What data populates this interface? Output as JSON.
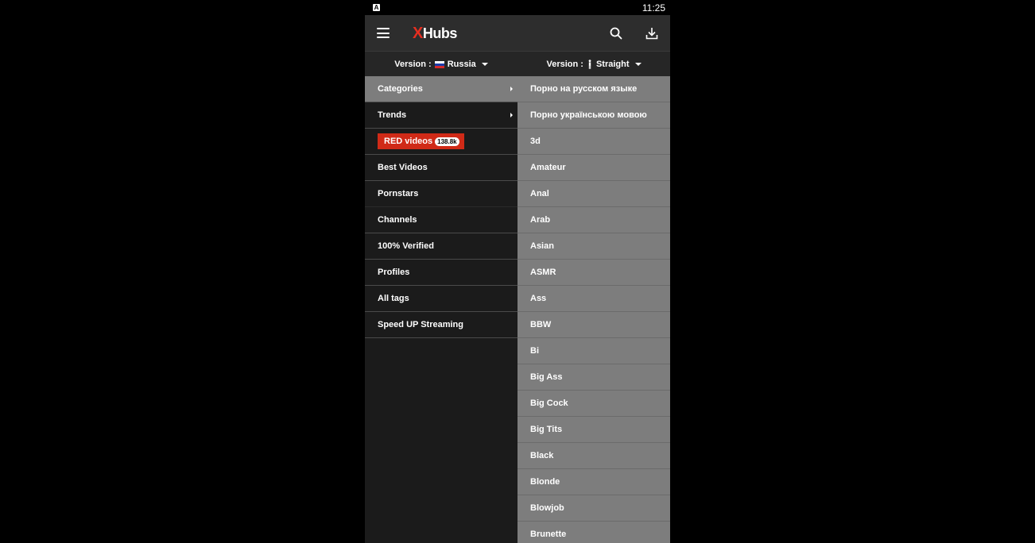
{
  "status": {
    "indicator": "A",
    "time": "11:25"
  },
  "appbar": {
    "logo_x": "X",
    "logo_rest": "Hubs",
    "search_icon": "search-icon",
    "download_icon": "download-icon"
  },
  "version": {
    "country_label": "Version :",
    "country_value": "Russia",
    "orientation_label": "Version :",
    "orientation_value": "Straight"
  },
  "menu": {
    "items": [
      {
        "label": "Categories"
      },
      {
        "label": "Trends"
      },
      {
        "label": "RED videos",
        "badge": "138.8k"
      },
      {
        "label": "Best Videos"
      },
      {
        "label": "Pornstars"
      },
      {
        "label": "Channels"
      },
      {
        "label": "100% Verified"
      },
      {
        "label": "Profiles"
      },
      {
        "label": "All tags"
      },
      {
        "label": "Speed UP Streaming"
      }
    ]
  },
  "categories": [
    "Порно на русском языке",
    "Порно українською мовою",
    "3d",
    "Amateur",
    "Anal",
    "Arab",
    "Asian",
    "ASMR",
    "Ass",
    "BBW",
    "Bi",
    "Big Ass",
    "Big Cock",
    "Big Tits",
    "Black",
    "Blonde",
    "Blowjob",
    "Brunette"
  ],
  "colors": {
    "accent": "#e62e20",
    "red_button": "#d02a17",
    "submenu_bg": "#7d7d7d"
  }
}
